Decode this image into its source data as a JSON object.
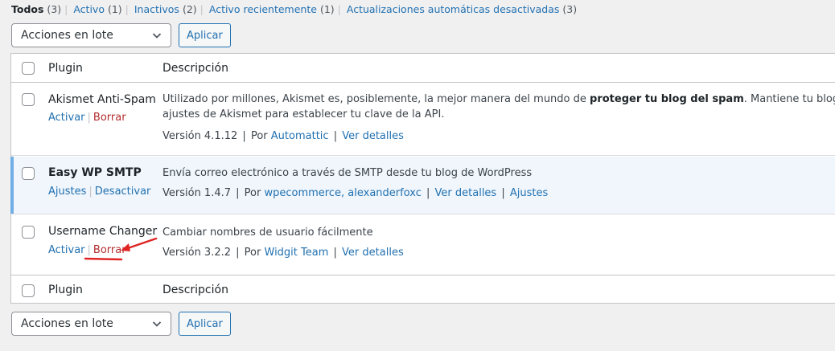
{
  "filters": [
    {
      "label": "Todos",
      "count": "(3)",
      "current": true
    },
    {
      "label": "Activo",
      "count": "(1)"
    },
    {
      "label": "Inactivos",
      "count": "(2)"
    },
    {
      "label": "Activo recientemente",
      "count": "(1)"
    },
    {
      "label": "Actualizaciones automáticas desactivadas",
      "count": "(3)"
    }
  ],
  "bulk_top": {
    "selected": "Acciones en lote",
    "apply": "Aplicar"
  },
  "bulk_bottom": {
    "selected": "Acciones en lote",
    "apply": "Aplicar"
  },
  "table": {
    "col_plugin": "Plugin",
    "col_desc": "Descripción",
    "plugins": [
      {
        "name": "Akismet Anti-Spam",
        "actions": [
          "Activar",
          "Borrar"
        ],
        "desc_line1_pre": "Utilizado por millones, Akismet es, posiblemente, la mejor manera del mundo de ",
        "desc_line1_bold": "proteger tu blog del spam",
        "desc_line1_post": ". Mantiene tu blog protegido inclus",
        "desc_line2": "ajustes de Akismet para establecer tu clave de la API.",
        "version": "Versión 4.1.12",
        "by": "Por",
        "author": "Automattic",
        "details": "Ver detalles"
      },
      {
        "name": "Easy WP SMTP",
        "actions": [
          "Ajustes",
          "Desactivar"
        ],
        "desc_line1": "Envía correo electrónico a través de SMTP desde tu blog de WordPress",
        "version": "Versión 1.4.7",
        "by": "Por",
        "author": "wpecommerce, alexanderfoxc",
        "details": "Ver detalles",
        "settings": "Ajustes"
      },
      {
        "name": "Username Changer",
        "actions": [
          "Activar",
          "Borrar"
        ],
        "desc_line1": "Cambiar nombres de usuario fácilmente",
        "version": "Versión 3.2.2",
        "by": "Por",
        "author": "Widgit Team",
        "details": "Ver detalles"
      }
    ]
  },
  "colors": {
    "link": "#2271b1",
    "delete": "#b32d2e",
    "active_bg": "#f0f6fc",
    "active_bar": "#72aee6",
    "annotation": "#e02424"
  },
  "icons": {
    "select": "chevron-down-icon",
    "annotation": "red-arrow-underline"
  }
}
